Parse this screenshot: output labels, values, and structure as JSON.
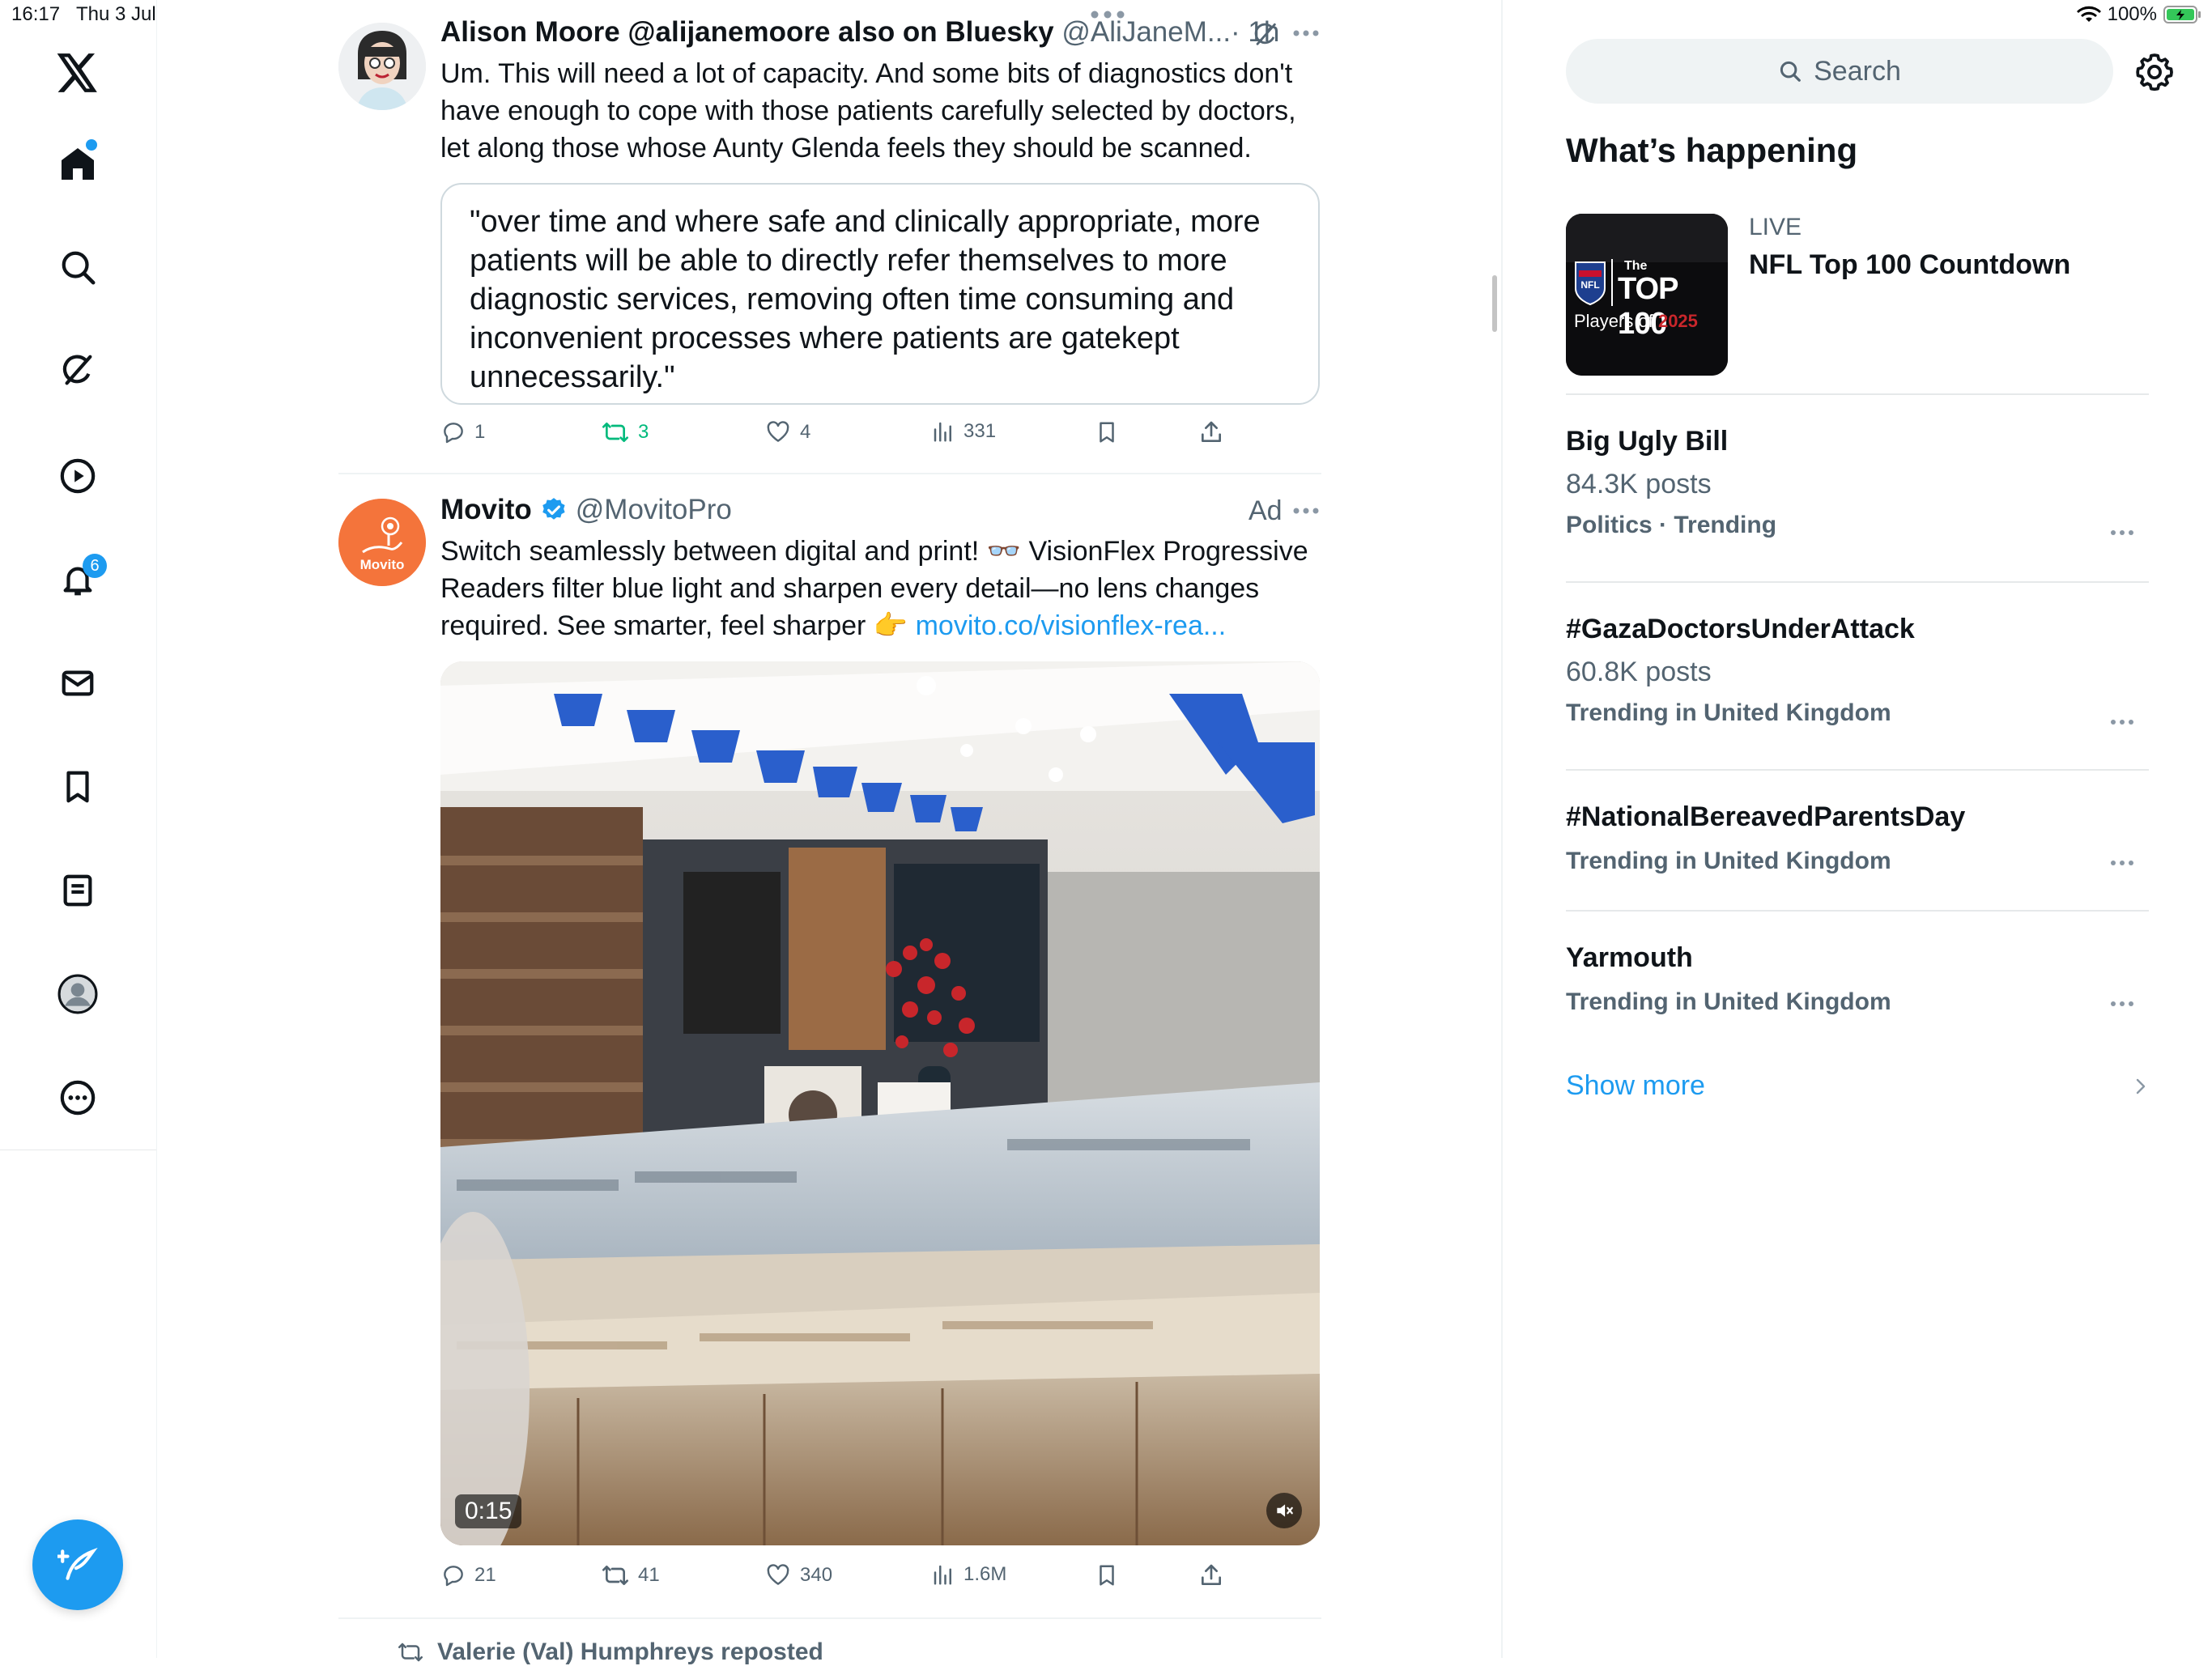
{
  "status_bar": {
    "time": "16:17",
    "date": "Thu 3 Jul",
    "battery": "100%"
  },
  "nav": {
    "notifications_badge": "6",
    "items": [
      "home",
      "explore",
      "grok",
      "video",
      "notifications",
      "messages",
      "bookmarks",
      "lists",
      "profile",
      "more"
    ]
  },
  "tweet1": {
    "name": "Alison Moore @alijanemoore also on Bluesky",
    "handle": "@AliJaneM...",
    "time": "· 1h",
    "body": "Um. This will need a lot of capacity. And some bits of diagnostics don't have enough to cope with those patients carefully selected by doctors, let along those whose Aunty Glenda feels they should be scanned.",
    "quote": "\"over time and where safe and clinically appropriate, more patients will be able to directly refer themselves to more diagnostic services, removing often time consuming and inconvenient processes where patients are gatekept unnecessarily.\"",
    "replies": "1",
    "reposts": "3",
    "likes": "4",
    "views": "331"
  },
  "tweet2": {
    "name": "Movito",
    "handle": "@MovitoPro",
    "ad_label": "Ad",
    "body": "Switch seamlessly between digital and print! 👓 VisionFlex Progressive Readers filter blue light and sharpen every detail—no lens changes required. See smarter, feel sharper 👉 ",
    "link": "movito.co/visionflex-rea...",
    "avatar_text": "Movito",
    "video_time": "0:15",
    "replies": "21",
    "reposts": "41",
    "likes": "340",
    "views": "1.6M"
  },
  "next_repost": "Valerie (Val) Humphreys reposted",
  "right": {
    "search_placeholder": "Search",
    "section_title": "What’s happening",
    "live": {
      "label": "LIVE",
      "title": "NFL Top 100 Countdown",
      "thumb_top": "The",
      "thumb_main": "TOP 100",
      "thumb_sub_a": "Players of",
      "thumb_sub_b": "2025"
    },
    "trends": [
      {
        "title": "Big Ugly Bill",
        "posts": "84.3K posts",
        "category": "Politics · Trending"
      },
      {
        "title": "#GazaDoctorsUnderAttack",
        "posts": "60.8K posts",
        "category": "Trending in United Kingdom"
      },
      {
        "title": "#NationalBereavedParentsDay",
        "posts": "",
        "category": "Trending in United Kingdom"
      },
      {
        "title": "Yarmouth",
        "posts": "",
        "category": "Trending in United Kingdom"
      }
    ],
    "show_more": "Show more"
  },
  "colors": {
    "accent": "#1d9bf0",
    "repost_green": "#00ba7c",
    "secondary_text": "#536471",
    "avatar_orange": "#f4743b"
  }
}
